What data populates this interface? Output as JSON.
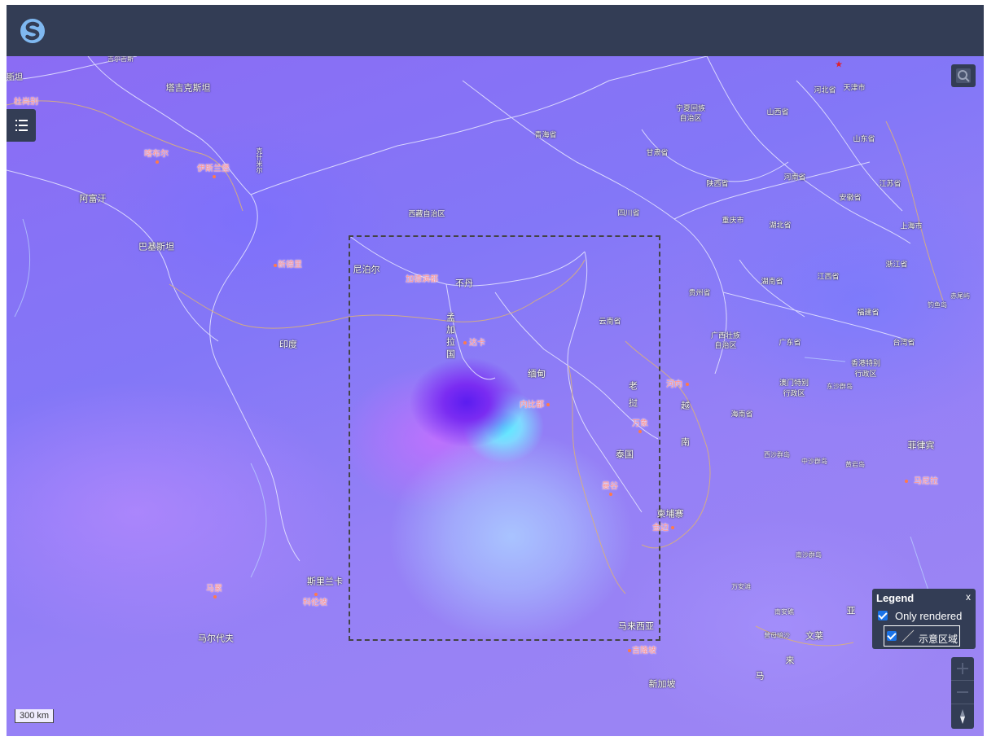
{
  "map": {
    "labels": {
      "tajikistan": "塔吉克斯坦",
      "pakistan_partial": "斯坦",
      "dushanbe_partial": "杜尚别",
      "afghanistan": "阿富汗",
      "pakistan": "巴基斯坦",
      "kabul": "喀布尔",
      "islamabad": "伊斯兰堡",
      "kashmir": "克什米尔",
      "new_delhi": "新德里",
      "india": "印度",
      "nepal": "尼泊尔",
      "kathmandu": "加德满都",
      "bhutan": "不丹",
      "bangladesh": "孟加拉国",
      "dhaka": "达卡",
      "myanmar": "缅甸",
      "naypyidaw": "内比都",
      "sri_lanka": "斯里兰卡",
      "colombo": "科伦坡",
      "maldives": "马尔代夫",
      "male": "马累",
      "laos": "老挝",
      "vientiane": "万象",
      "thailand": "泰国",
      "bangkok": "曼谷",
      "vietnam": "越南",
      "hanoi": "河内",
      "cambodia": "柬埔寨",
      "phnom_penh": "金边",
      "malaysia": "马来西亚",
      "kuala_lumpur": "吉隆坡",
      "singapore": "新加坡",
      "brunei": "文莱",
      "philippines": "菲律宾",
      "manila": "马尼拉",
      "malay_ma": "马",
      "malay_lai": "来",
      "malay_ya": "亚",
      "xizang": "西藏自治区",
      "qinghai": "青海省",
      "sichuan": "四川省",
      "yunnan": "云南省",
      "gansu": "甘肃省",
      "ningxia": "宁夏回族自治区",
      "shaanxi": "陕西省",
      "shanxi": "山西省",
      "hebei": "河北省",
      "tianjin": "天津市",
      "shandong": "山东省",
      "henan": "河南省",
      "jiangsu": "江苏省",
      "anhui": "安徽省",
      "shanghai": "上海市",
      "hubei": "湖北省",
      "chongqing": "重庆市",
      "zhejiang": "浙江省",
      "jiangxi": "江西省",
      "hunan": "湖南省",
      "guizhou": "贵州省",
      "fujian": "福建省",
      "guangxi": "广西壮族自治区",
      "guangdong": "广东省",
      "taiwan": "台湾省",
      "hongkong": "香港特别行政区",
      "macau": "澳门特别行政区",
      "hainan": "海南省",
      "dongsha": "东沙群岛",
      "xisha": "西沙群岛",
      "zhongsha": "中沙群岛",
      "huangyan": "黄岩岛",
      "nansha": "南沙群岛",
      "wanan": "万安滩",
      "nanan": "南安礁",
      "zengmu": "曾母暗沙",
      "diaoyu": "钓鱼岛",
      "chiwei": "赤尾屿",
      "kyrgyz_partial": "吉尔吉斯"
    }
  },
  "legend": {
    "title": "Legend",
    "close": "x",
    "only_rendered": "Only rendered",
    "layer_name": "示意区域"
  },
  "scale": {
    "label": "300 km"
  },
  "colors": {
    "topbar": "#333d55",
    "city_label": "#ff8f8f",
    "accent": "#1a73e8"
  }
}
